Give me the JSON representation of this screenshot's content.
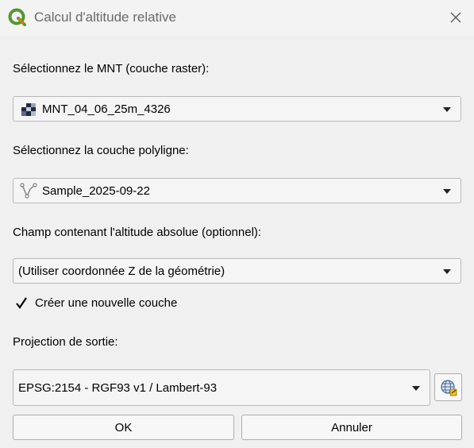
{
  "window": {
    "title": "Calcul d'altitude relative",
    "app_icon": "qgis-logo-icon",
    "close_icon": "close-icon"
  },
  "dem": {
    "label": "Sélectionnez le MNT (couche raster):",
    "selected": "MNT_04_06_25m_4326",
    "icon": "raster-layer-icon"
  },
  "polyline": {
    "label": "Sélectionnez la couche polyligne:",
    "selected": "Sample_2025-09-22",
    "icon": "line-layer-icon"
  },
  "altitude_field": {
    "label": "Champ contenant l'altitude absolue (optionnel):",
    "selected": "(Utiliser coordonnée Z de la géométrie)"
  },
  "new_layer": {
    "label": "Créer une nouvelle couche",
    "checked": true
  },
  "projection": {
    "label": "Projection de sortie:",
    "selected": "EPSG:2154 - RGF93 v1 / Lambert-93",
    "button_icon": "crs-selector-icon"
  },
  "buttons": {
    "ok": "OK",
    "cancel": "Annuler"
  }
}
